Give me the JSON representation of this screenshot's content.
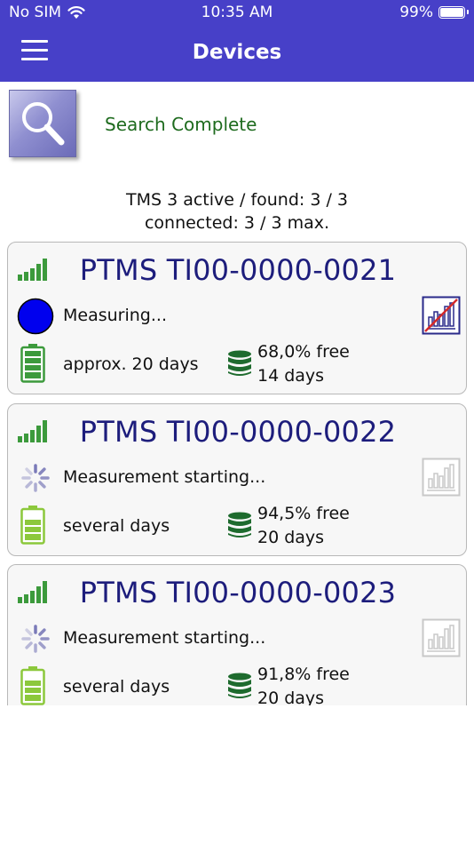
{
  "status_bar": {
    "carrier": "No SIM",
    "time": "10:35 AM",
    "battery_percent": "99%"
  },
  "nav": {
    "title": "Devices",
    "menu_icon": "hamburger-menu-icon"
  },
  "search": {
    "icon": "magnifier-icon",
    "status": "Search Complete"
  },
  "summary": {
    "line1": "TMS 3 active / found: 3 / 3",
    "line2": "connected: 3 / 3 max."
  },
  "colors": {
    "header_bg": "#4740c8",
    "device_name": "#1d1d7c",
    "search_status": "#1e6b1e",
    "battery_green": "#3c9a3c",
    "battery_lightgreen": "#8cc83c",
    "storage_green": "#1e6b2e",
    "measuring_blue": "#0000ee"
  },
  "devices": [
    {
      "name": "PTMS TI00-0000-0021",
      "state": "Measuring...",
      "state_icon": "measuring-dot-icon",
      "battery": "approx. 20 days",
      "battery_level": 1.0,
      "storage_free": "68,0% free",
      "storage_days": "14 days",
      "chart_enabled": true
    },
    {
      "name": "PTMS TI00-0000-0022",
      "state": "Measurement starting...",
      "state_icon": "loading-spinner-icon",
      "battery": "several days",
      "battery_level": 0.75,
      "storage_free": "94,5% free",
      "storage_days": "20 days",
      "chart_enabled": false
    },
    {
      "name": "PTMS TI00-0000-0023",
      "state": "Measurement starting...",
      "state_icon": "loading-spinner-icon",
      "battery": "several days",
      "battery_level": 0.75,
      "storage_free": "91,8% free",
      "storage_days": "20 days",
      "chart_enabled": false
    }
  ]
}
